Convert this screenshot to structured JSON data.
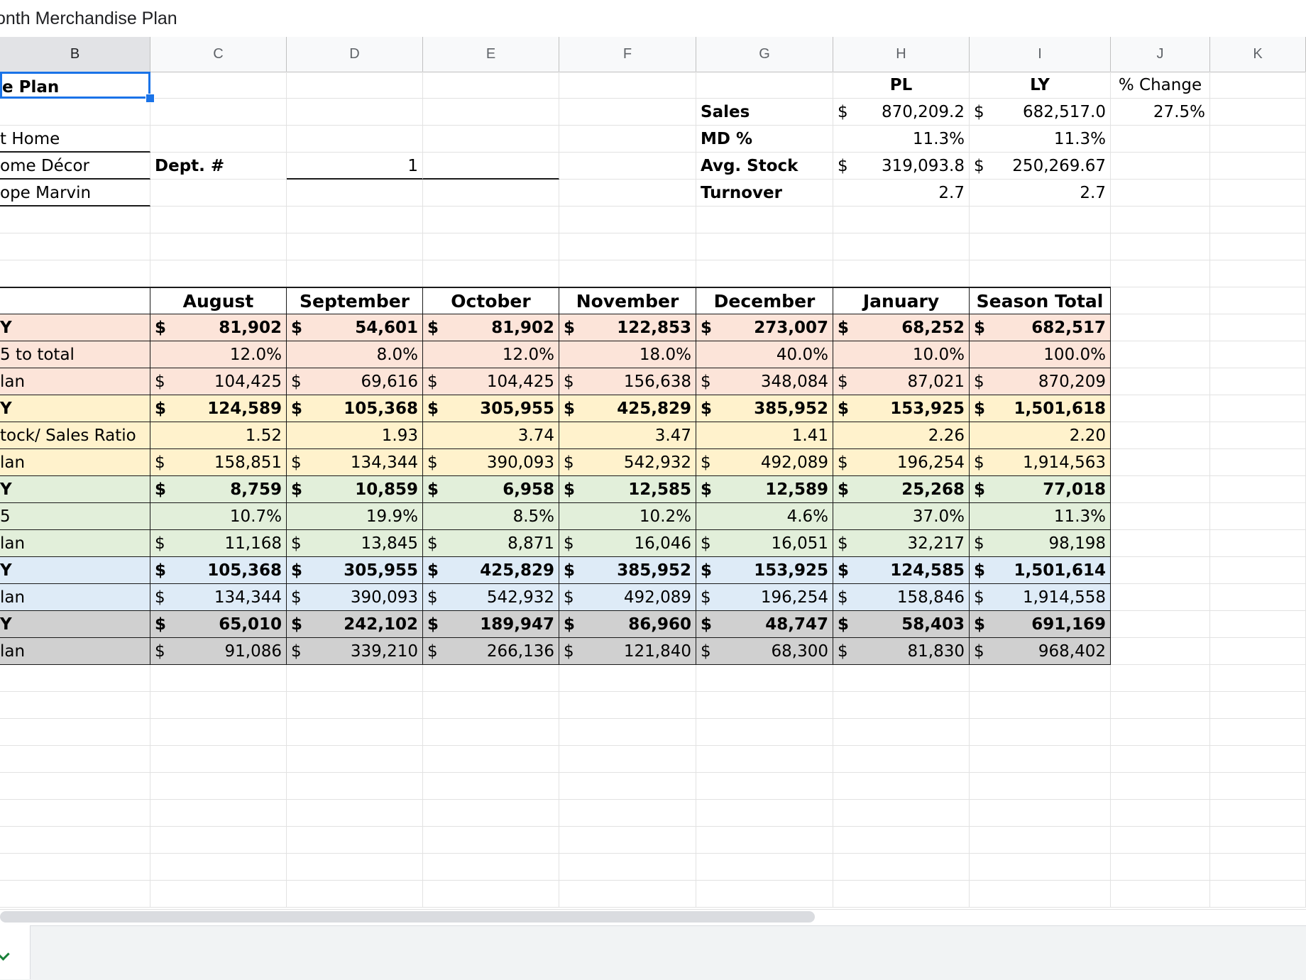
{
  "window": {
    "title": "onth Merchandise Plan"
  },
  "columns": [
    "B",
    "C",
    "D",
    "E",
    "F",
    "G",
    "H",
    "I",
    "J",
    "K"
  ],
  "selected_column": "B",
  "header_block": {
    "b_labels": [
      "e Plan",
      "",
      "t Home",
      "ome Décor",
      "ope Marvin"
    ],
    "dept_label": "Dept. #",
    "dept_value": "1"
  },
  "summary": {
    "col_headers": [
      "PL",
      "LY",
      "% Change"
    ],
    "rows": [
      {
        "label": "Sales",
        "pl_cur": "$",
        "pl": "870,209.2",
        "ly_cur": "$",
        "ly": "682,517.0",
        "change": "27.5%"
      },
      {
        "label": "MD %",
        "pl_cur": "",
        "pl": "11.3%",
        "ly_cur": "",
        "ly": "11.3%",
        "change": ""
      },
      {
        "label": "Avg. Stock",
        "pl_cur": "$",
        "pl": "319,093.8",
        "ly_cur": "$",
        "ly": "250,269.67",
        "change": ""
      },
      {
        "label": "Turnover",
        "pl_cur": "",
        "pl": "2.7",
        "ly_cur": "",
        "ly": "2.7",
        "change": ""
      }
    ]
  },
  "plan_table": {
    "months": [
      "August",
      "September",
      "October",
      "November",
      "December",
      "January",
      "Season Total"
    ],
    "rows": [
      {
        "label": "Y",
        "color": "salmon",
        "bold": true,
        "currency": true,
        "values": [
          "81,902",
          "54,601",
          "81,902",
          "122,853",
          "273,007",
          "68,252",
          "682,517"
        ]
      },
      {
        "label": "5 to total",
        "color": "salmon",
        "bold": false,
        "currency": false,
        "values": [
          "12.0%",
          "8.0%",
          "12.0%",
          "18.0%",
          "40.0%",
          "10.0%",
          "100.0%"
        ]
      },
      {
        "label": "lan",
        "color": "salmon",
        "bold": false,
        "currency": true,
        "values": [
          "104,425",
          "69,616",
          "104,425",
          "156,638",
          "348,084",
          "87,021",
          "870,209"
        ]
      },
      {
        "label": "Y",
        "color": "yellow",
        "bold": true,
        "currency": true,
        "values": [
          "124,589",
          "105,368",
          "305,955",
          "425,829",
          "385,952",
          "153,925",
          "1,501,618"
        ]
      },
      {
        "label": "tock/ Sales Ratio",
        "color": "yellow",
        "bold": false,
        "currency": false,
        "values": [
          "1.52",
          "1.93",
          "3.74",
          "3.47",
          "1.41",
          "2.26",
          "2.20"
        ]
      },
      {
        "label": "lan",
        "color": "yellow",
        "bold": false,
        "currency": true,
        "values": [
          "158,851",
          "134,344",
          "390,093",
          "542,932",
          "492,089",
          "196,254",
          "1,914,563"
        ]
      },
      {
        "label": "Y",
        "color": "green",
        "bold": true,
        "currency": true,
        "values": [
          "8,759",
          "10,859",
          "6,958",
          "12,585",
          "12,589",
          "25,268",
          "77,018"
        ]
      },
      {
        "label": "5",
        "color": "green",
        "bold": false,
        "currency": false,
        "values": [
          "10.7%",
          "19.9%",
          "8.5%",
          "10.2%",
          "4.6%",
          "37.0%",
          "11.3%"
        ]
      },
      {
        "label": "lan",
        "color": "green",
        "bold": false,
        "currency": true,
        "values": [
          "11,168",
          "13,845",
          "8,871",
          "16,046",
          "16,051",
          "32,217",
          "98,198"
        ]
      },
      {
        "label": "Y",
        "color": "blue",
        "bold": true,
        "currency": true,
        "values": [
          "105,368",
          "305,955",
          "425,829",
          "385,952",
          "153,925",
          "124,585",
          "1,501,614"
        ]
      },
      {
        "label": "lan",
        "color": "blue",
        "bold": false,
        "currency": true,
        "values": [
          "134,344",
          "390,093",
          "542,932",
          "492,089",
          "196,254",
          "158,846",
          "1,914,558"
        ]
      },
      {
        "label": "Y",
        "color": "gray",
        "bold": true,
        "currency": true,
        "values": [
          "65,010",
          "242,102",
          "189,947",
          "86,960",
          "48,747",
          "58,403",
          "691,169"
        ]
      },
      {
        "label": "lan",
        "color": "gray",
        "bold": false,
        "currency": true,
        "values": [
          "91,086",
          "339,210",
          "266,136",
          "121,840",
          "68,300",
          "81,830",
          "968,402"
        ]
      }
    ]
  },
  "colors": {
    "salmon": "#fce4d9",
    "yellow": "#fff2cc",
    "green": "#e2efda",
    "blue": "#deebf7",
    "gray": "#d0d0d0",
    "selection": "#1a73e8"
  }
}
